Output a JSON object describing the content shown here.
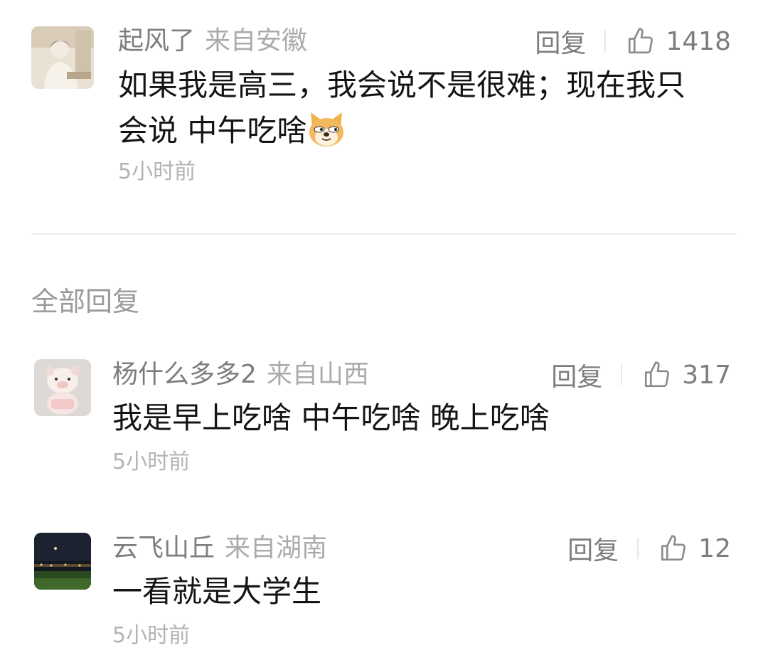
{
  "main_comment": {
    "author": "起风了",
    "location": "来自安徽",
    "reply_label": "回复",
    "likes": "1418",
    "text_line1": "如果我是高三，我会说不是很难；现在我只",
    "text_line2": "会说 中午吃啥",
    "emoji_icon": "doge-emoji-icon",
    "time": "5小时前"
  },
  "replies_section": {
    "title": "全部回复"
  },
  "replies": [
    {
      "author": "杨什么多多2",
      "location": "来自山西",
      "reply_label": "回复",
      "likes": "317",
      "text": "我是早上吃啥 中午吃啥 晚上吃啥",
      "time": "5小时前"
    },
    {
      "author": "云飞山丘",
      "location": "来自湖南",
      "reply_label": "回复",
      "likes": "12",
      "text": "一看就是大学生",
      "time": "5小时前"
    }
  ],
  "colors": {
    "name": "#7d7d7d",
    "location": "#ababab",
    "content": "#141414",
    "time": "#b3b3b3",
    "divider": "#eeeeee"
  }
}
